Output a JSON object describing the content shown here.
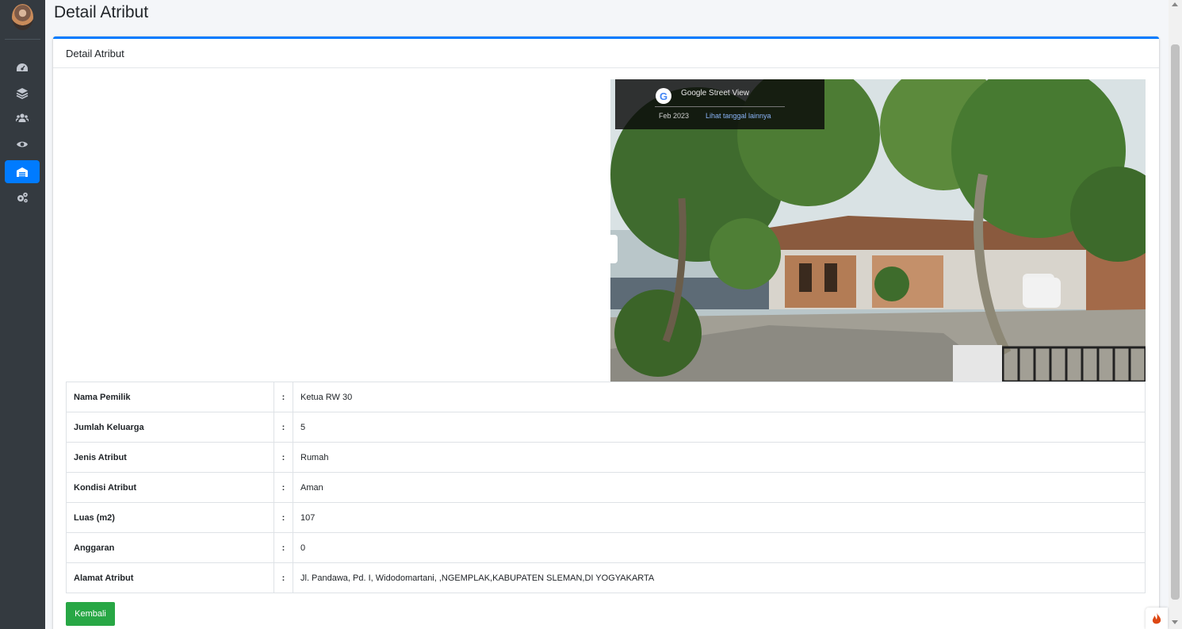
{
  "page": {
    "title": "Detail Atribut"
  },
  "card": {
    "header": "Detail Atribut"
  },
  "photo": {
    "source_label": "Google Street View",
    "date": "Feb 2023",
    "more_dates_link": "Lihat tanggal lainnya"
  },
  "details": [
    {
      "label": "Nama Pemilik",
      "sep": ":",
      "value": "Ketua RW 30"
    },
    {
      "label": "Jumlah Keluarga",
      "sep": ":",
      "value": "5"
    },
    {
      "label": "Jenis Atribut",
      "sep": ":",
      "value": "Rumah"
    },
    {
      "label": "Kondisi Atribut",
      "sep": ":",
      "value": "Aman"
    },
    {
      "label": "Luas (m2)",
      "sep": ":",
      "value": "107"
    },
    {
      "label": "Anggaran",
      "sep": ":",
      "value": "0"
    },
    {
      "label": "Alamat Atribut",
      "sep": ":",
      "value": "Jl. Pandawa, Pd. I, Widodomartani, ,NGEMPLAK,KABUPATEN SLEMAN,DI YOGYAKARTA"
    }
  ],
  "actions": {
    "back_label": "Kembali"
  },
  "sidebar": {
    "items": [
      {
        "icon": "dashboard-icon"
      },
      {
        "icon": "layers-icon"
      },
      {
        "icon": "users-icon"
      },
      {
        "icon": "eye-icon"
      },
      {
        "icon": "warehouse-icon",
        "active": true
      },
      {
        "icon": "gears-icon"
      }
    ]
  },
  "colors": {
    "accent": "#007bff",
    "sidebar": "#343a40",
    "success": "#28a745"
  }
}
